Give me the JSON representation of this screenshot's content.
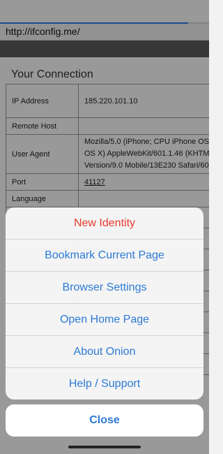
{
  "browser": {
    "url": "http://ifconfig.me/",
    "load_progress": 0.9
  },
  "page": {
    "heading": "Your Connection",
    "rows": [
      {
        "key": "IP Address",
        "value": "185.220.101.10"
      },
      {
        "key": "Remote Host",
        "value": ""
      },
      {
        "key": "User Agent",
        "value_lines": [
          "Mozilla/5.0 (iPhone; CPU iPhone OS",
          "OS X) AppleWebKit/601.1.46 (KHTM",
          "Version/9.0 Mobile/13E230 Safari/60"
        ]
      },
      {
        "key": "Port",
        "value": "41127"
      },
      {
        "key": "Language",
        "value": ""
      }
    ]
  },
  "action_sheet": {
    "items": [
      {
        "label": "New Identity",
        "style": "destructive"
      },
      {
        "label": "Bookmark Current Page"
      },
      {
        "label": "Browser Settings"
      },
      {
        "label": "Open Home Page"
      },
      {
        "label": "About Onion"
      },
      {
        "label": "Help / Support"
      }
    ],
    "cancel_label": "Close"
  },
  "colors": {
    "accent": "#2b7ad6",
    "destructive": "#e8392f",
    "progress": "#2e7bf0"
  }
}
